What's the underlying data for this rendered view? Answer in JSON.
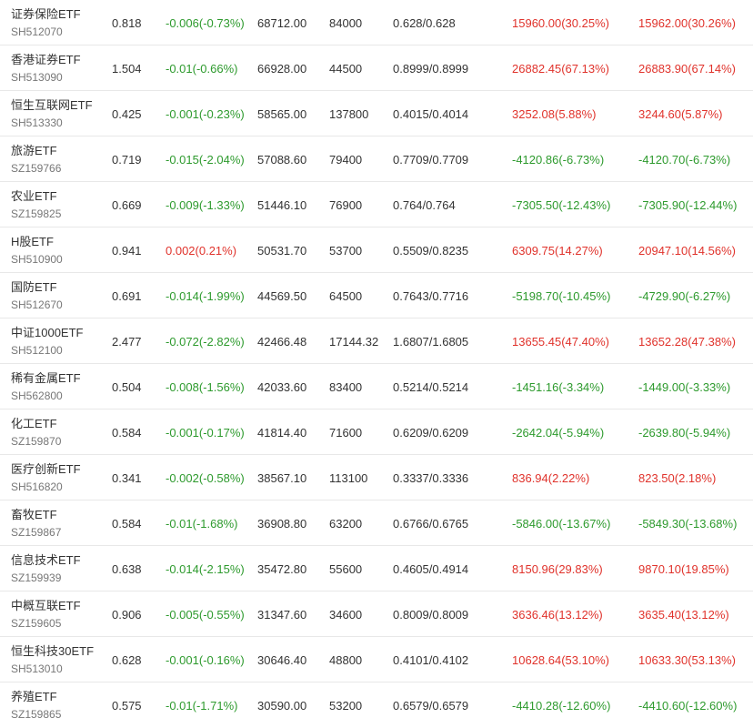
{
  "colors": {
    "up": "#e0322b",
    "down": "#2d9a2d"
  },
  "rows": [
    {
      "name": "证券保险ETF",
      "code": "SH512070",
      "price": "0.818",
      "change": "-0.006(-0.73%)",
      "change_dir": "down",
      "amount": "68712.00",
      "volume": "84000",
      "bid_ask": "0.628/0.628",
      "metric1": "15960.00(30.25%)",
      "metric1_dir": "up",
      "metric2": "15962.00(30.26%)",
      "metric2_dir": "up"
    },
    {
      "name": "香港证券ETF",
      "code": "SH513090",
      "price": "1.504",
      "change": "-0.01(-0.66%)",
      "change_dir": "down",
      "amount": "66928.00",
      "volume": "44500",
      "bid_ask": "0.8999/0.8999",
      "metric1": "26882.45(67.13%)",
      "metric1_dir": "up",
      "metric2": "26883.90(67.14%)",
      "metric2_dir": "up"
    },
    {
      "name": "恒生互联网ETF",
      "code": "SH513330",
      "price": "0.425",
      "change": "-0.001(-0.23%)",
      "change_dir": "down",
      "amount": "58565.00",
      "volume": "137800",
      "bid_ask": "0.4015/0.4014",
      "metric1": "3252.08(5.88%)",
      "metric1_dir": "up",
      "metric2": "3244.60(5.87%)",
      "metric2_dir": "up"
    },
    {
      "name": "旅游ETF",
      "code": "SZ159766",
      "price": "0.719",
      "change": "-0.015(-2.04%)",
      "change_dir": "down",
      "amount": "57088.60",
      "volume": "79400",
      "bid_ask": "0.7709/0.7709",
      "metric1": "-4120.86(-6.73%)",
      "metric1_dir": "down",
      "metric2": "-4120.70(-6.73%)",
      "metric2_dir": "down"
    },
    {
      "name": "农业ETF",
      "code": "SZ159825",
      "price": "0.669",
      "change": "-0.009(-1.33%)",
      "change_dir": "down",
      "amount": "51446.10",
      "volume": "76900",
      "bid_ask": "0.764/0.764",
      "metric1": "-7305.50(-12.43%)",
      "metric1_dir": "down",
      "metric2": "-7305.90(-12.44%)",
      "metric2_dir": "down"
    },
    {
      "name": "H股ETF",
      "code": "SH510900",
      "price": "0.941",
      "change": "0.002(0.21%)",
      "change_dir": "up",
      "amount": "50531.70",
      "volume": "53700",
      "bid_ask": "0.5509/0.8235",
      "metric1": "6309.75(14.27%)",
      "metric1_dir": "up",
      "metric2": "20947.10(14.56%)",
      "metric2_dir": "up"
    },
    {
      "name": "国防ETF",
      "code": "SH512670",
      "price": "0.691",
      "change": "-0.014(-1.99%)",
      "change_dir": "down",
      "amount": "44569.50",
      "volume": "64500",
      "bid_ask": "0.7643/0.7716",
      "metric1": "-5198.70(-10.45%)",
      "metric1_dir": "down",
      "metric2": "-4729.90(-6.27%)",
      "metric2_dir": "down"
    },
    {
      "name": "中证1000ETF",
      "code": "SH512100",
      "price": "2.477",
      "change": "-0.072(-2.82%)",
      "change_dir": "down",
      "amount": "42466.48",
      "volume": "17144.32",
      "bid_ask": "1.6807/1.6805",
      "metric1": "13655.45(47.40%)",
      "metric1_dir": "up",
      "metric2": "13652.28(47.38%)",
      "metric2_dir": "up"
    },
    {
      "name": "稀有金属ETF",
      "code": "SH562800",
      "price": "0.504",
      "change": "-0.008(-1.56%)",
      "change_dir": "down",
      "amount": "42033.60",
      "volume": "83400",
      "bid_ask": "0.5214/0.5214",
      "metric1": "-1451.16(-3.34%)",
      "metric1_dir": "down",
      "metric2": "-1449.00(-3.33%)",
      "metric2_dir": "down"
    },
    {
      "name": "化工ETF",
      "code": "SZ159870",
      "price": "0.584",
      "change": "-0.001(-0.17%)",
      "change_dir": "down",
      "amount": "41814.40",
      "volume": "71600",
      "bid_ask": "0.6209/0.6209",
      "metric1": "-2642.04(-5.94%)",
      "metric1_dir": "down",
      "metric2": "-2639.80(-5.94%)",
      "metric2_dir": "down"
    },
    {
      "name": "医疗创新ETF",
      "code": "SH516820",
      "price": "0.341",
      "change": "-0.002(-0.58%)",
      "change_dir": "down",
      "amount": "38567.10",
      "volume": "113100",
      "bid_ask": "0.3337/0.3336",
      "metric1": "836.94(2.22%)",
      "metric1_dir": "up",
      "metric2": "823.50(2.18%)",
      "metric2_dir": "up"
    },
    {
      "name": "畜牧ETF",
      "code": "SZ159867",
      "price": "0.584",
      "change": "-0.01(-1.68%)",
      "change_dir": "down",
      "amount": "36908.80",
      "volume": "63200",
      "bid_ask": "0.6766/0.6765",
      "metric1": "-5846.00(-13.67%)",
      "metric1_dir": "down",
      "metric2": "-5849.30(-13.68%)",
      "metric2_dir": "down"
    },
    {
      "name": "信息技术ETF",
      "code": "SZ159939",
      "price": "0.638",
      "change": "-0.014(-2.15%)",
      "change_dir": "down",
      "amount": "35472.80",
      "volume": "55600",
      "bid_ask": "0.4605/0.4914",
      "metric1": "8150.96(29.83%)",
      "metric1_dir": "up",
      "metric2": "9870.10(19.85%)",
      "metric2_dir": "up"
    },
    {
      "name": "中概互联ETF",
      "code": "SZ159605",
      "price": "0.906",
      "change": "-0.005(-0.55%)",
      "change_dir": "down",
      "amount": "31347.60",
      "volume": "34600",
      "bid_ask": "0.8009/0.8009",
      "metric1": "3636.46(13.12%)",
      "metric1_dir": "up",
      "metric2": "3635.40(13.12%)",
      "metric2_dir": "up"
    },
    {
      "name": "恒生科技30ETF",
      "code": "SH513010",
      "price": "0.628",
      "change": "-0.001(-0.16%)",
      "change_dir": "down",
      "amount": "30646.40",
      "volume": "48800",
      "bid_ask": "0.4101/0.4102",
      "metric1": "10628.64(53.10%)",
      "metric1_dir": "up",
      "metric2": "10633.30(53.13%)",
      "metric2_dir": "up"
    },
    {
      "name": "养殖ETF",
      "code": "SZ159865",
      "price": "0.575",
      "change": "-0.01(-1.71%)",
      "change_dir": "down",
      "amount": "30590.00",
      "volume": "53200",
      "bid_ask": "0.6579/0.6579",
      "metric1": "-4410.28(-12.60%)",
      "metric1_dir": "down",
      "metric2": "-4410.60(-12.60%)",
      "metric2_dir": "down"
    }
  ]
}
